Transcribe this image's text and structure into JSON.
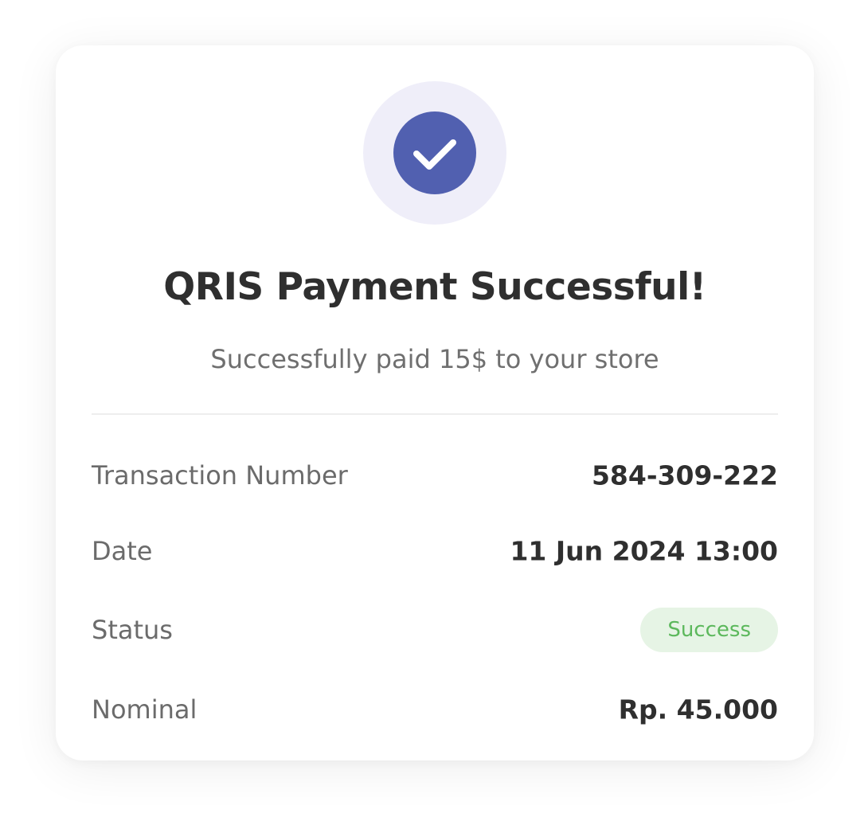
{
  "title": "QRIS Payment Successful!",
  "subtitle": "Successfully paid 15$ to your store",
  "details": [
    {
      "label": "Transaction Number",
      "value": "584-309-222"
    },
    {
      "label": "Date",
      "value": "11 Jun 2024 13:00"
    },
    {
      "label": "Status",
      "value": "Success"
    },
    {
      "label": "Nominal",
      "value": "Rp. 45.000"
    }
  ],
  "icon": "check-icon",
  "colors": {
    "accent": "#5160b0",
    "accent_soft": "#efeef9",
    "success_text": "#5cb85c",
    "success_bg": "#e6f4e5",
    "text_primary": "#2f2f2f",
    "text_secondary": "#6b6b6b"
  }
}
